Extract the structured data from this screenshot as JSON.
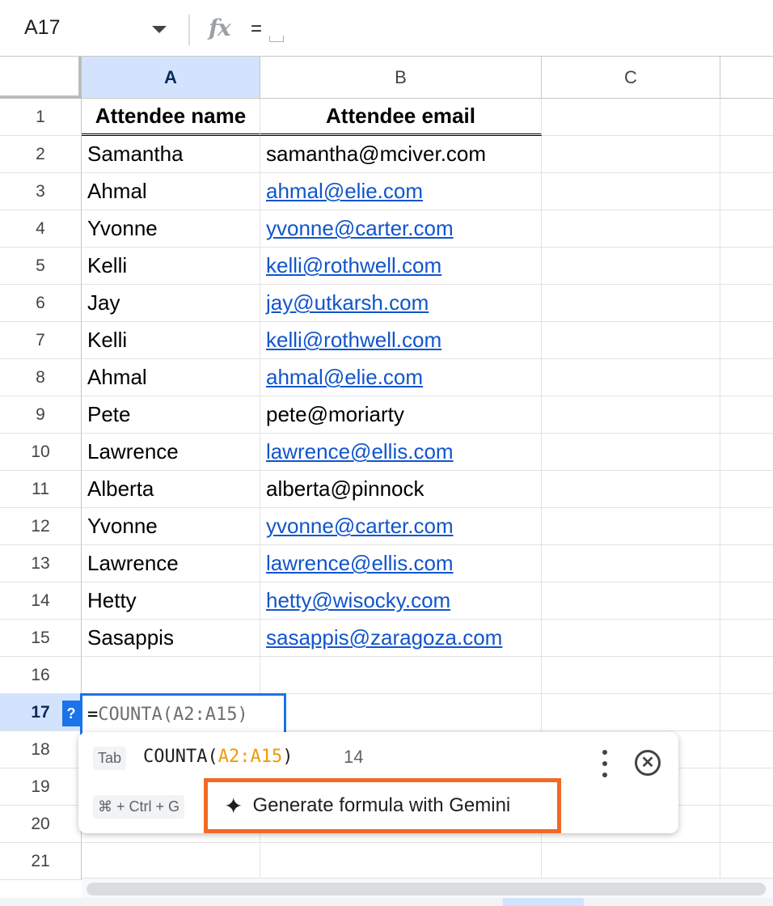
{
  "formula_bar": {
    "name_box": "A17",
    "fx_symbol": "fx",
    "value": "="
  },
  "columns": [
    "A",
    "B",
    "C"
  ],
  "selected_column": "A",
  "rows": [
    {
      "num": "1",
      "a": "Attendee name",
      "b": "Attendee email",
      "b_link": false
    },
    {
      "num": "2",
      "a": "Samantha",
      "b": "samantha@mciver.com",
      "b_link": false
    },
    {
      "num": "3",
      "a": "Ahmal",
      "b": "ahmal@elie.com",
      "b_link": true
    },
    {
      "num": "4",
      "a": "Yvonne",
      "b": "yvonne@carter.com",
      "b_link": true
    },
    {
      "num": "5",
      "a": "Kelli",
      "b": "kelli@rothwell.com",
      "b_link": true
    },
    {
      "num": "6",
      "a": "Jay",
      "b": "jay@utkarsh.com",
      "b_link": true
    },
    {
      "num": "7",
      "a": "Kelli",
      "b": "kelli@rothwell.com",
      "b_link": true
    },
    {
      "num": "8",
      "a": "Ahmal",
      "b": "ahmal@elie.com",
      "b_link": true
    },
    {
      "num": "9",
      "a": "Pete",
      "b": "pete@moriarty",
      "b_link": false
    },
    {
      "num": "10",
      "a": "Lawrence",
      "b": "lawrence@ellis.com",
      "b_link": true
    },
    {
      "num": "11",
      "a": "Alberta",
      "b": "alberta@pinnock",
      "b_link": false
    },
    {
      "num": "12",
      "a": "Yvonne",
      "b": "yvonne@carter.com",
      "b_link": true
    },
    {
      "num": "13",
      "a": "Lawrence",
      "b": "lawrence@ellis.com",
      "b_link": true
    },
    {
      "num": "14",
      "a": "Hetty",
      "b": "hetty@wisocky.com",
      "b_link": true
    },
    {
      "num": "15",
      "a": "Sasappis",
      "b": "sasappis@zaragoza.com",
      "b_link": true
    },
    {
      "num": "16",
      "a": "",
      "b": "",
      "b_link": false
    },
    {
      "num": "17",
      "a": "",
      "b": "",
      "b_link": false
    },
    {
      "num": "18",
      "a": "",
      "b": "",
      "b_link": false
    },
    {
      "num": "19",
      "a": "",
      "b": "",
      "b_link": false
    },
    {
      "num": "20",
      "a": "",
      "b": "",
      "b_link": false
    },
    {
      "num": "21",
      "a": "",
      "b": "",
      "b_link": false
    }
  ],
  "active_row": "17",
  "editor": {
    "help_badge": "?",
    "eq": "=",
    "formula": "COUNTA(A2:A15)"
  },
  "suggestion": {
    "tab_key": "Tab",
    "func_open": "COUNTA(",
    "range": "A2:A15",
    "func_close": ")",
    "result": "14",
    "shortcut": "⌘ + Ctrl + G",
    "gemini_label": "Generate formula with Gemini",
    "close_symbol": "✕"
  },
  "colors": {
    "link": "#1155cc",
    "selection": "#d3e3fd",
    "active_border": "#1a73e8",
    "highlight_border": "#f06a26",
    "range_color": "#f29900"
  }
}
